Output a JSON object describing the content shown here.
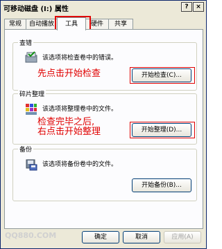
{
  "window": {
    "title": "可移动磁盘 (I:) 属性",
    "help_btn": "?",
    "close_btn": "×"
  },
  "tabs": [
    {
      "label": "常规"
    },
    {
      "label": "自动播放"
    },
    {
      "label": "工具"
    },
    {
      "label": "硬件"
    },
    {
      "label": "共享"
    }
  ],
  "groups": {
    "check": {
      "label": "查错",
      "desc": "该选项将检查卷中的错误。",
      "button": "开始检查(C)...",
      "icon": "disk-check-icon"
    },
    "defrag": {
      "label": "碎片整理",
      "desc": "该选项将整理卷中的文件。",
      "button": "开始整理(D)...",
      "icon": "defrag-icon"
    },
    "backup": {
      "label": "备份",
      "desc": "该选项将备份卷中的文件。",
      "button": "开始备份(B)...",
      "icon": "backup-icon"
    }
  },
  "annotations": {
    "first": "先点击开始检查",
    "second_l1": "检查完毕之后,",
    "second_l2": "右点击开始整理"
  },
  "footer": {
    "ok": "确定",
    "cancel": "取消",
    "apply": "应用(A)"
  },
  "watermark": "QQ880.COM",
  "colors": {
    "annotation": "#e00000",
    "title_border": "#0a246a"
  }
}
